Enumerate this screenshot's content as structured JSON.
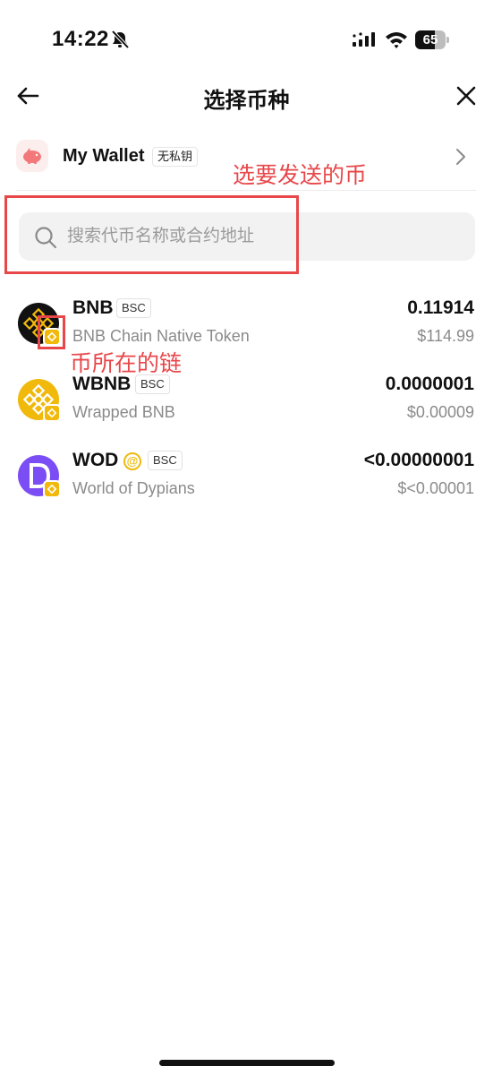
{
  "status_bar": {
    "time": "14:22",
    "battery_level": "65",
    "battery_fraction": 0.65
  },
  "nav": {
    "title": "选择币种"
  },
  "wallet": {
    "name": "My Wallet",
    "badge": "无私钥"
  },
  "search": {
    "placeholder": "搜索代币名称或合约地址",
    "value": ""
  },
  "annotations": {
    "send_hint": "选要发送的币",
    "chain_hint": "币所在的链"
  },
  "tokens": [
    {
      "symbol": "BNB",
      "tag": "BSC",
      "name": "BNB Chain Native Token",
      "amount": "0.11914",
      "value": "$114.99",
      "icon": "bnb-icon"
    },
    {
      "symbol": "WBNB",
      "tag": "BSC",
      "name": "Wrapped BNB",
      "amount": "0.0000001",
      "value": "$0.00009",
      "icon": "wbnb-icon"
    },
    {
      "symbol": "WOD",
      "tag": "BSC",
      "name": "World of Dypians",
      "amount": "<0.00000001",
      "value": "$<0.00001",
      "icon": "wod-icon"
    }
  ],
  "colors": {
    "accent_red": "#e8474a",
    "bnb_yellow": "#f0b90b",
    "wod_purple": "#7b4df5"
  }
}
